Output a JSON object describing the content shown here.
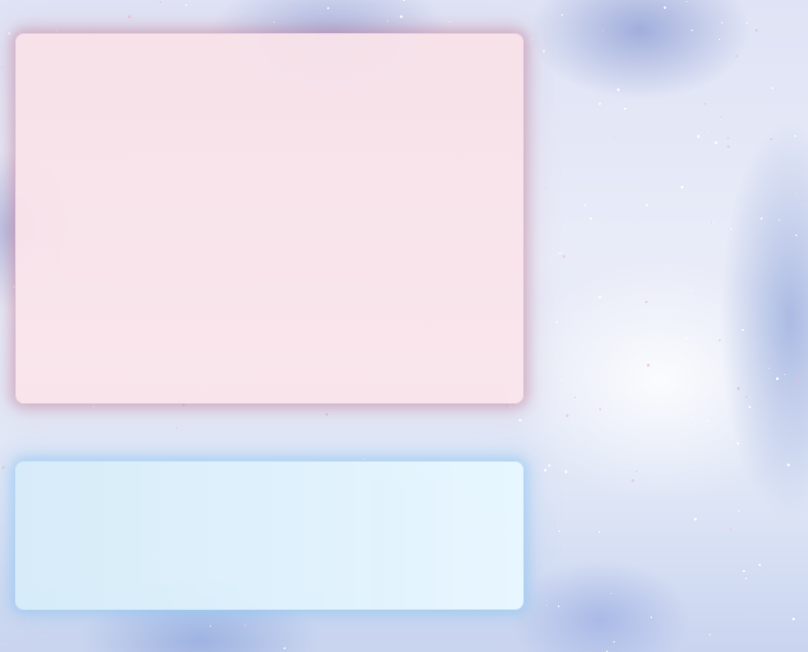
{
  "theme": {
    "top_panel_color": "#F8E3EA",
    "bottom_panel_color": "#DDEFFA",
    "background_color": "#E4E8F6"
  },
  "panels": [
    {
      "name": "top-panel",
      "content": ""
    },
    {
      "name": "bottom-panel",
      "content": ""
    }
  ]
}
